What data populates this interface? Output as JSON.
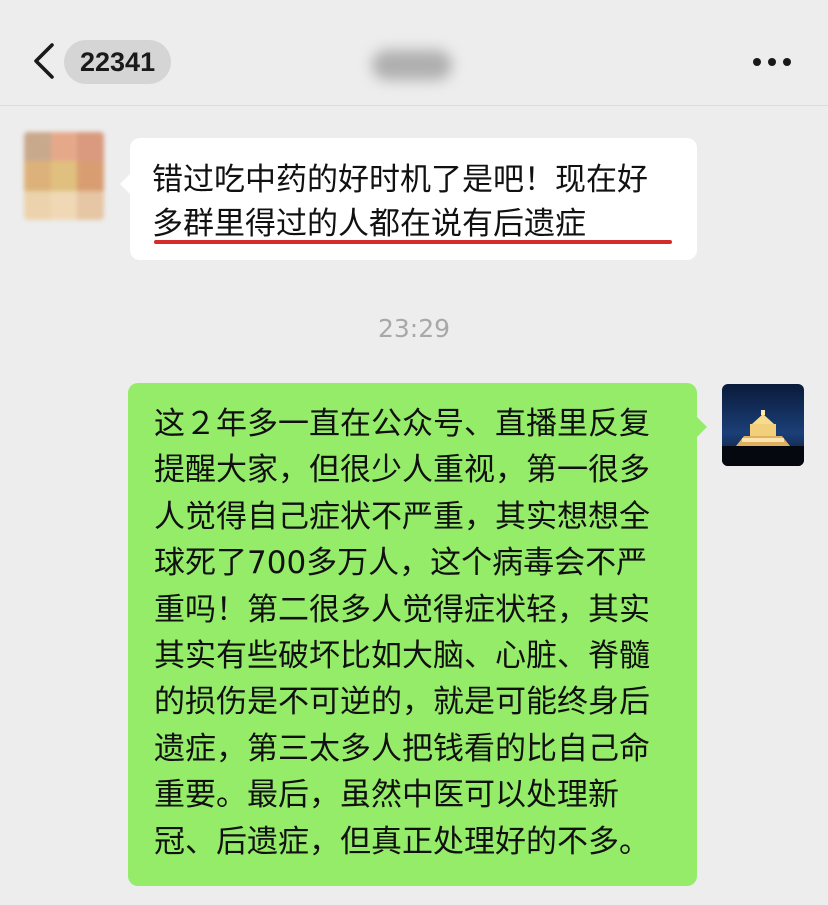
{
  "header": {
    "unread_count": "22341",
    "back_icon": "chevron-left-icon",
    "more_icon": "ellipsis-icon"
  },
  "messages": [
    {
      "side": "left",
      "text": "错过吃中药的好时机了是吧！现在好多群里得过的人都在说有后遗症"
    },
    {
      "side": "right",
      "text": "这２年多一直在公众号、直播里反复提醒大家，但很少人重视，第一很多人觉得自己症状不严重，其实想想全球死了700多万人，这个病毒会不严重吗！第二很多人觉得症状轻，其实其实有些破坏比如大脑、心脏、脊髓的损伤是不可逆的，就是可能终身后遗症，第三太多人把钱看的比自己命重要。最后，虽然中医可以处理新冠、后遗症，但真正处理好的不多。"
    }
  ],
  "timestamp": "23:29",
  "colors": {
    "background": "#ededed",
    "sent_bubble": "#95ec69",
    "received_bubble": "#ffffff",
    "underline": "#d42b2b"
  }
}
